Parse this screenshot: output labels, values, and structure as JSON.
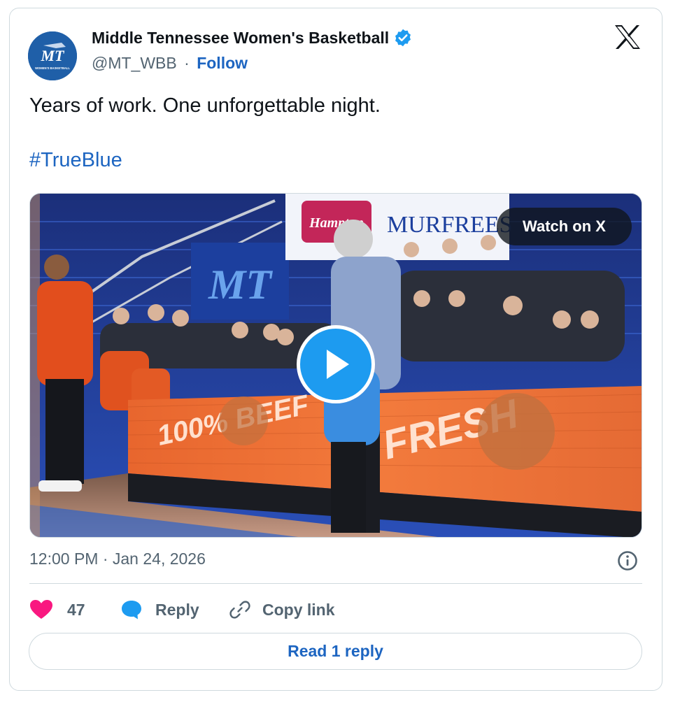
{
  "author": {
    "name": "Middle Tennessee Women's Basketball",
    "handle": "@MT_WBB",
    "separator": "·",
    "follow_label": "Follow",
    "avatar_logo_text": "MT",
    "avatar_sub_text": "WOMEN'S BASKETBALL"
  },
  "tweet": {
    "text": "Years of work. One unforgettable night.",
    "hashtag": "#TrueBlue"
  },
  "media": {
    "watch_label": "Watch on X",
    "scoreboard_brand": "Hampton",
    "scoreboard_city": "MURFREES",
    "ad_text_1": "100% BEEF",
    "ad_text_2": "FRESH",
    "arena_logo": "MT"
  },
  "meta": {
    "timestamp": "12:00 PM · Jan 24, 2026"
  },
  "actions": {
    "likes_count": "47",
    "reply_label": "Reply",
    "copy_link_label": "Copy link",
    "read_replies_label": "Read 1 reply"
  },
  "colors": {
    "link_blue": "#1d65c1",
    "verified_blue": "#1d9bf0",
    "heart_pink": "#f91880",
    "muted_text": "#536471",
    "border": "#cfd9de"
  },
  "icons": [
    "x-logo-icon",
    "verified-badge-icon",
    "play-icon",
    "info-icon",
    "heart-icon",
    "reply-bubble-icon",
    "link-icon"
  ]
}
